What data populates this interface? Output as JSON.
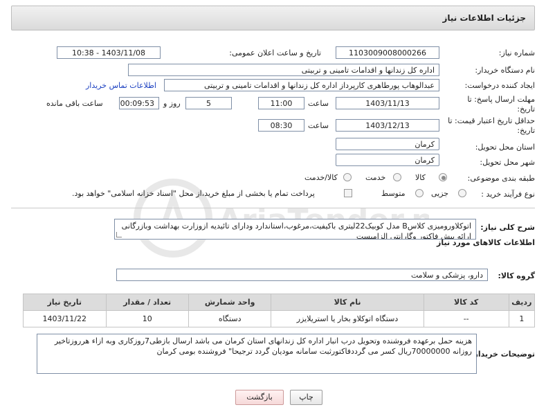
{
  "header": {
    "title": "جزئیات اطلاعات نیاز"
  },
  "labels": {
    "need_number": "شماره نیاز:",
    "announce_datetime": "تاریخ و ساعت اعلان عمومی:",
    "buyer_org": "نام دستگاه خریدار:",
    "requester": "ایجاد کننده درخواست:",
    "reply_deadline_line1": "مهلت ارسال پاسخ: تا",
    "reply_deadline_line2": "تاریخ:",
    "price_validity_line1": "حداقل تاریخ اعتبار قیمت: تا",
    "price_validity_line2": "تاریخ:",
    "hour": "ساعت",
    "day_and": "روز و",
    "remaining_time": "ساعت باقی مانده",
    "province": "استان محل تحویل:",
    "city": "شهر محل تحویل:",
    "category": "طبقه بندی موضوعی:",
    "purchase_type": "نوع فرآیند خرید :",
    "need_desc": "شرح کلی نیاز:",
    "goods_info": "اطلاعات کالاهای مورد نیاز",
    "goods_group": "گروه کالا:",
    "buyer_notes": "توضیحات خریدار:"
  },
  "values": {
    "need_number": "1103009008000266",
    "announce_datetime": "1403/11/08 - 10:38",
    "buyer_org": "اداره کل زندانها و اقدامات تامینی و تربیتی",
    "requester": "عبدالوهاب پورطاهری کارپرداز اداره کل زندانها و اقدامات تامینی و تربیتی",
    "contact_link": "اطلاعات تماس خریدار",
    "reply_date": "1403/11/13",
    "reply_time": "11:00",
    "reply_days": "5",
    "reply_remaining": "00:09:53",
    "validity_date": "1403/12/13",
    "validity_time": "08:30",
    "province": "کرمان",
    "city": "کرمان",
    "goods_group": "دارو، پزشکی و سلامت"
  },
  "category_options": [
    {
      "label": "کالا",
      "selected": true
    },
    {
      "label": "خدمت",
      "selected": false
    },
    {
      "label": "کالا/خدمت",
      "selected": false
    }
  ],
  "purchase_options": [
    {
      "label": "جزیی",
      "selected": false
    },
    {
      "label": "متوسط",
      "selected": false
    }
  ],
  "payment_checkbox_label": "پرداخت تمام یا بخشی از مبلغ خرید،از محل \"اسناد خزانه اسلامی\" خواهد بود.",
  "need_description": "اتوکلاورومیزی کلاسB مدل کوبیک22لیتری باکیفیت،مرغوب،استاندارد ودارای تائیدیه ازوزارت بهداشت وبازرگانی ارائه پیش فاکتور وگارانتی الزامیست",
  "table": {
    "headers": [
      "ردیف",
      "کد کالا",
      "نام کالا",
      "واحد شمارش",
      "تعداد / مقدار",
      "تاریخ نیاز"
    ],
    "rows": [
      [
        "1",
        "--",
        "دستگاه اتوکلاو بخار یا استریلایزر",
        "دستگاه",
        "10",
        "1403/11/22"
      ]
    ]
  },
  "buyer_notes": "هزینه حمل برعهده فروشنده وتحویل درب انبار اداره کل زندانهای استان کرمان می باشد ارسال بازطی7روزکاری وبه ازاء هرروزتاخیر روزانه 70000000ریال کسر می گرددفاکتورثبت سامانه مودیان گردد ترجیحا\" فروشنده بومی کرمان",
  "buttons": {
    "print": "چاپ",
    "back": "بازگشت"
  },
  "watermark_text": "AriaTender.neT"
}
